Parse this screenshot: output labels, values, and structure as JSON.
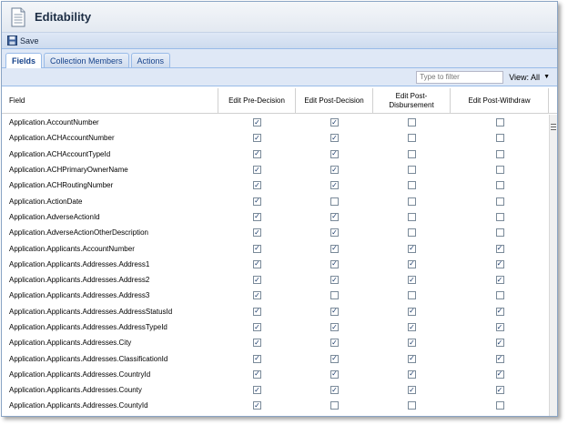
{
  "window": {
    "title": "Editability"
  },
  "toolbar": {
    "save_label": "Save"
  },
  "tabs": [
    {
      "label": "Fields",
      "active": true
    },
    {
      "label": "Collection Members",
      "active": false
    },
    {
      "label": "Actions",
      "active": false
    }
  ],
  "filter": {
    "placeholder": "Type to filter",
    "view_label": "View: All"
  },
  "grid": {
    "columns": [
      "Field",
      "Edit Pre-Decision",
      "Edit Post-Decision",
      "Edit Post-\nDisbursement",
      "Edit Post-Withdraw"
    ],
    "rows": [
      {
        "field": "Application.AccountNumber",
        "checks": [
          true,
          true,
          false,
          false
        ]
      },
      {
        "field": "Application.ACHAccountNumber",
        "checks": [
          true,
          true,
          false,
          false
        ]
      },
      {
        "field": "Application.ACHAccountTypeId",
        "checks": [
          true,
          true,
          false,
          false
        ]
      },
      {
        "field": "Application.ACHPrimaryOwnerName",
        "checks": [
          true,
          true,
          false,
          false
        ]
      },
      {
        "field": "Application.ACHRoutingNumber",
        "checks": [
          true,
          true,
          false,
          false
        ]
      },
      {
        "field": "Application.ActionDate",
        "checks": [
          true,
          false,
          false,
          false
        ]
      },
      {
        "field": "Application.AdverseActionId",
        "checks": [
          true,
          true,
          false,
          false
        ]
      },
      {
        "field": "Application.AdverseActionOtherDescription",
        "checks": [
          true,
          true,
          false,
          false
        ]
      },
      {
        "field": "Application.Applicants.AccountNumber",
        "checks": [
          true,
          true,
          true,
          true
        ]
      },
      {
        "field": "Application.Applicants.Addresses.Address1",
        "checks": [
          true,
          true,
          true,
          true
        ]
      },
      {
        "field": "Application.Applicants.Addresses.Address2",
        "checks": [
          true,
          true,
          true,
          true
        ]
      },
      {
        "field": "Application.Applicants.Addresses.Address3",
        "checks": [
          true,
          false,
          false,
          false
        ]
      },
      {
        "field": "Application.Applicants.Addresses.AddressStatusId",
        "checks": [
          true,
          true,
          true,
          true
        ]
      },
      {
        "field": "Application.Applicants.Addresses.AddressTypeId",
        "checks": [
          true,
          true,
          true,
          true
        ]
      },
      {
        "field": "Application.Applicants.Addresses.City",
        "checks": [
          true,
          true,
          true,
          true
        ]
      },
      {
        "field": "Application.Applicants.Addresses.ClassificationId",
        "checks": [
          true,
          true,
          true,
          true
        ]
      },
      {
        "field": "Application.Applicants.Addresses.CountryId",
        "checks": [
          true,
          true,
          true,
          true
        ]
      },
      {
        "field": "Application.Applicants.Addresses.County",
        "checks": [
          true,
          true,
          true,
          true
        ]
      },
      {
        "field": "Application.Applicants.Addresses.CountyId",
        "checks": [
          true,
          false,
          false,
          false
        ]
      }
    ]
  },
  "colors": {
    "accent": "#99bbe8",
    "header_bg": "#dfe8f6",
    "title_text": "#1c2d44"
  }
}
